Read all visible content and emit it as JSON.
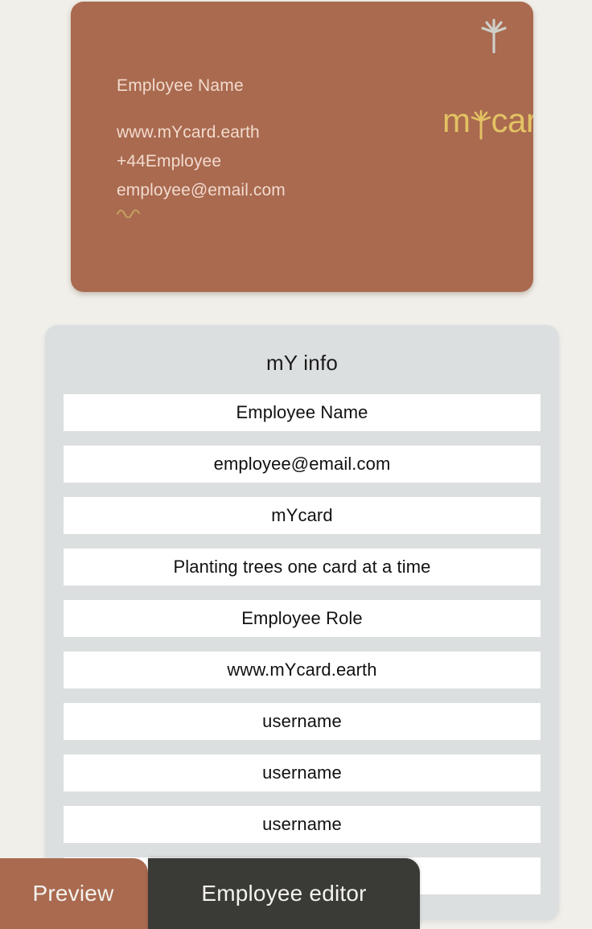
{
  "page": {
    "background_color": "#F1EFEA"
  },
  "card_preview": {
    "background_color": "#A96A4F",
    "text_color": "#F2DACE",
    "logo_color": "#E3C263",
    "tree_icon_color": "#CFCFC9",
    "name": "Employee Name",
    "contact_lines": [
      "www.mYcard.earth",
      "+44Employee",
      "employee@email.com"
    ],
    "logo": {
      "prefix": "m",
      "tree_letter": "Y",
      "suffix": "card",
      "full_text": "mYcard"
    },
    "icons": {
      "corner": "tree-icon",
      "squiggle": "squiggle-divider-icon"
    }
  },
  "info_panel": {
    "background_color": "#DBDFDF",
    "field_background_color": "#FFFFFF",
    "title": "mY info",
    "fields": [
      {
        "value": "Employee Name"
      },
      {
        "value": "employee@email.com"
      },
      {
        "value": "mYcard"
      },
      {
        "value": "Planting trees one card at a time"
      },
      {
        "value": "Employee Role"
      },
      {
        "value": "www.mYcard.earth"
      },
      {
        "value": "username"
      },
      {
        "value": "username"
      },
      {
        "value": "username"
      },
      {
        "value": ""
      }
    ]
  },
  "tab_bar": {
    "tabs": [
      {
        "label": "Preview",
        "color": "#A96A4F",
        "active": false
      },
      {
        "label": "Employee editor",
        "color": "#3A3A36",
        "active": true
      }
    ]
  }
}
